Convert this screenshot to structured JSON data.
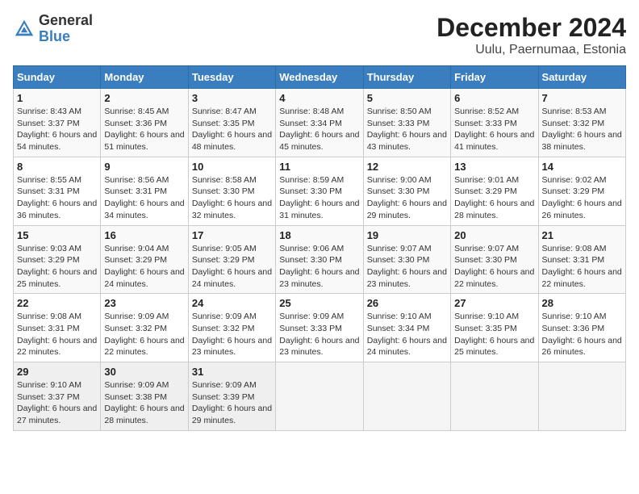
{
  "header": {
    "logo_line1": "General",
    "logo_line2": "Blue",
    "title": "December 2024",
    "subtitle": "Uulu, Paernumaa, Estonia"
  },
  "calendar": {
    "weekdays": [
      "Sunday",
      "Monday",
      "Tuesday",
      "Wednesday",
      "Thursday",
      "Friday",
      "Saturday"
    ],
    "weeks": [
      [
        {
          "day": "1",
          "sunrise": "8:43 AM",
          "sunset": "3:37 PM",
          "daylight": "6 hours and 54 minutes."
        },
        {
          "day": "2",
          "sunrise": "8:45 AM",
          "sunset": "3:36 PM",
          "daylight": "6 hours and 51 minutes."
        },
        {
          "day": "3",
          "sunrise": "8:47 AM",
          "sunset": "3:35 PM",
          "daylight": "6 hours and 48 minutes."
        },
        {
          "day": "4",
          "sunrise": "8:48 AM",
          "sunset": "3:34 PM",
          "daylight": "6 hours and 45 minutes."
        },
        {
          "day": "5",
          "sunrise": "8:50 AM",
          "sunset": "3:33 PM",
          "daylight": "6 hours and 43 minutes."
        },
        {
          "day": "6",
          "sunrise": "8:52 AM",
          "sunset": "3:33 PM",
          "daylight": "6 hours and 41 minutes."
        },
        {
          "day": "7",
          "sunrise": "8:53 AM",
          "sunset": "3:32 PM",
          "daylight": "6 hours and 38 minutes."
        }
      ],
      [
        {
          "day": "8",
          "sunrise": "8:55 AM",
          "sunset": "3:31 PM",
          "daylight": "6 hours and 36 minutes."
        },
        {
          "day": "9",
          "sunrise": "8:56 AM",
          "sunset": "3:31 PM",
          "daylight": "6 hours and 34 minutes."
        },
        {
          "day": "10",
          "sunrise": "8:58 AM",
          "sunset": "3:30 PM",
          "daylight": "6 hours and 32 minutes."
        },
        {
          "day": "11",
          "sunrise": "8:59 AM",
          "sunset": "3:30 PM",
          "daylight": "6 hours and 31 minutes."
        },
        {
          "day": "12",
          "sunrise": "9:00 AM",
          "sunset": "3:30 PM",
          "daylight": "6 hours and 29 minutes."
        },
        {
          "day": "13",
          "sunrise": "9:01 AM",
          "sunset": "3:29 PM",
          "daylight": "6 hours and 28 minutes."
        },
        {
          "day": "14",
          "sunrise": "9:02 AM",
          "sunset": "3:29 PM",
          "daylight": "6 hours and 26 minutes."
        }
      ],
      [
        {
          "day": "15",
          "sunrise": "9:03 AM",
          "sunset": "3:29 PM",
          "daylight": "6 hours and 25 minutes."
        },
        {
          "day": "16",
          "sunrise": "9:04 AM",
          "sunset": "3:29 PM",
          "daylight": "6 hours and 24 minutes."
        },
        {
          "day": "17",
          "sunrise": "9:05 AM",
          "sunset": "3:29 PM",
          "daylight": "6 hours and 24 minutes."
        },
        {
          "day": "18",
          "sunrise": "9:06 AM",
          "sunset": "3:30 PM",
          "daylight": "6 hours and 23 minutes."
        },
        {
          "day": "19",
          "sunrise": "9:07 AM",
          "sunset": "3:30 PM",
          "daylight": "6 hours and 23 minutes."
        },
        {
          "day": "20",
          "sunrise": "9:07 AM",
          "sunset": "3:30 PM",
          "daylight": "6 hours and 22 minutes."
        },
        {
          "day": "21",
          "sunrise": "9:08 AM",
          "sunset": "3:31 PM",
          "daylight": "6 hours and 22 minutes."
        }
      ],
      [
        {
          "day": "22",
          "sunrise": "9:08 AM",
          "sunset": "3:31 PM",
          "daylight": "6 hours and 22 minutes."
        },
        {
          "day": "23",
          "sunrise": "9:09 AM",
          "sunset": "3:32 PM",
          "daylight": "6 hours and 22 minutes."
        },
        {
          "day": "24",
          "sunrise": "9:09 AM",
          "sunset": "3:32 PM",
          "daylight": "6 hours and 23 minutes."
        },
        {
          "day": "25",
          "sunrise": "9:09 AM",
          "sunset": "3:33 PM",
          "daylight": "6 hours and 23 minutes."
        },
        {
          "day": "26",
          "sunrise": "9:10 AM",
          "sunset": "3:34 PM",
          "daylight": "6 hours and 24 minutes."
        },
        {
          "day": "27",
          "sunrise": "9:10 AM",
          "sunset": "3:35 PM",
          "daylight": "6 hours and 25 minutes."
        },
        {
          "day": "28",
          "sunrise": "9:10 AM",
          "sunset": "3:36 PM",
          "daylight": "6 hours and 26 minutes."
        }
      ],
      [
        {
          "day": "29",
          "sunrise": "9:10 AM",
          "sunset": "3:37 PM",
          "daylight": "6 hours and 27 minutes."
        },
        {
          "day": "30",
          "sunrise": "9:09 AM",
          "sunset": "3:38 PM",
          "daylight": "6 hours and 28 minutes."
        },
        {
          "day": "31",
          "sunrise": "9:09 AM",
          "sunset": "3:39 PM",
          "daylight": "6 hours and 29 minutes."
        },
        null,
        null,
        null,
        null
      ]
    ]
  }
}
